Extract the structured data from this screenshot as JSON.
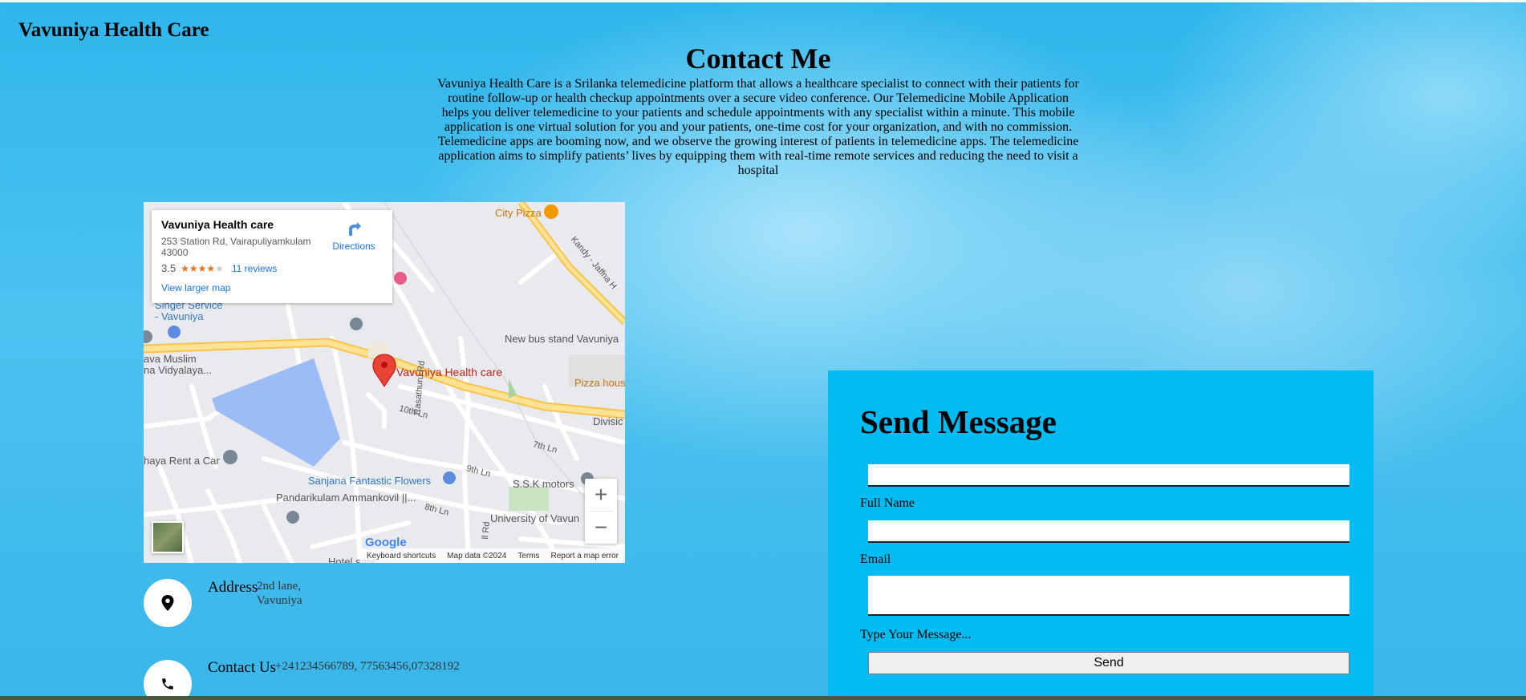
{
  "header": {
    "brand": "Vavuniya Health Care"
  },
  "page": {
    "title": "Contact Me",
    "intro": "Vavuniya Health Care is a Srilanka telemedicine platform that allows a healthcare specialist to connect with their patients for routine follow-up or health checkup appointments over a secure video conference. Our Telemedicine Mobile Application helps you deliver telemedicine to your patients and schedule appointments with any specialist within a minute. This mobile application is one virtual solution for you and your patients, one-time cost for your organization, and with no commission. Telemedicine apps are booming now, and we observe the growing interest of patients in telemedicine apps. The telemedicine application aims to simplify patients’ lives by equipping them with real-time remote services and reducing the need to visit a hospital"
  },
  "map": {
    "card": {
      "name": "Vavuniya Health care",
      "address": "253 Station Rd, Vairapuliyamkulam 43000",
      "rating": "3.5",
      "stars_filled": "★★★★",
      "stars_empty": "★",
      "reviews": "11 reviews",
      "larger_map": "View larger map",
      "directions": "Directions"
    },
    "labels": {
      "city_pizza": "City Pizza",
      "kandy_road": "Kandy - Jaffna H",
      "singer_1": "Singer Service",
      "singer_2": "- Vavuniya",
      "new_bus_stand": "New bus stand Vavuniya",
      "muslim_1": "ava Muslim",
      "muslim_2": "na Vidyalaya...",
      "health_care": "Vavuniya Health care",
      "pizza_house": "Pizza hous",
      "tenth_ln": "10th Ln",
      "rasathuru_rd": "Rasathuru Rd",
      "seventh_ln": "7th Ln",
      "divisional": "Divisic",
      "rent_a_car": "haya Rent a Car",
      "ninth_ln": "9th Ln",
      "ssk_motors": "S.S.K motors",
      "sanjana": "Sanjana Fantastic Flowers",
      "pandarikulam": "Pandarikulam Ammankovil ||...",
      "eighth_ln": "8th Ln",
      "university": "University of Vavun",
      "hotel": "Hotel soly",
      "ll_rd": "ll Rd"
    },
    "zoom_in": "+",
    "zoom_out": "−",
    "google": "Google",
    "footer": {
      "shortcuts": "Keyboard shortcuts",
      "data": "Map data ©2024",
      "terms": "Terms",
      "report": "Report a map error"
    }
  },
  "contact": {
    "address_title": "Address",
    "address_line1": "2nd lane,",
    "address_line2": "Vavuniya",
    "contact_title": "Contact Us",
    "contact_value": "+241234566789, 77563456,07328192"
  },
  "form": {
    "title": "Send Message",
    "name_label": "Full Name",
    "email_label": "Email",
    "message_label": "Type Your Message...",
    "send_label": "Send"
  },
  "colors": {
    "form_panel": "#00bcf2",
    "page_blue": "#2fb6ec",
    "map_pin": "#ea4335"
  }
}
